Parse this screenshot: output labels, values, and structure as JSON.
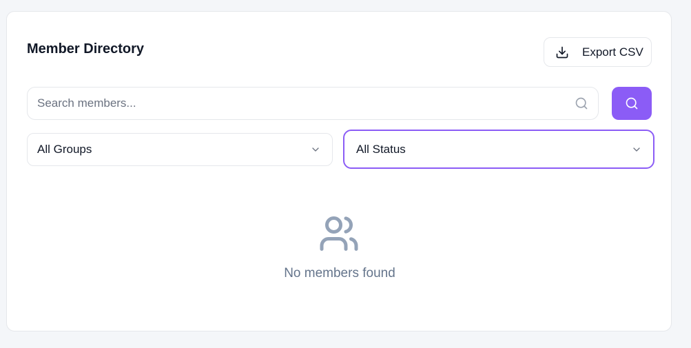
{
  "header": {
    "title": "Member Directory",
    "export_label": "Export CSV"
  },
  "search": {
    "placeholder": "Search members...",
    "value": ""
  },
  "filters": {
    "groups_selected": "All Groups",
    "status_selected": "All Status"
  },
  "empty_state": {
    "message": "No members found",
    "icon": "users-icon"
  },
  "colors": {
    "accent": "#8b5cf6",
    "text_primary": "#111827",
    "text_muted": "#64748b",
    "border": "#e5e7eb",
    "page_bg": "#f4f6f9"
  }
}
